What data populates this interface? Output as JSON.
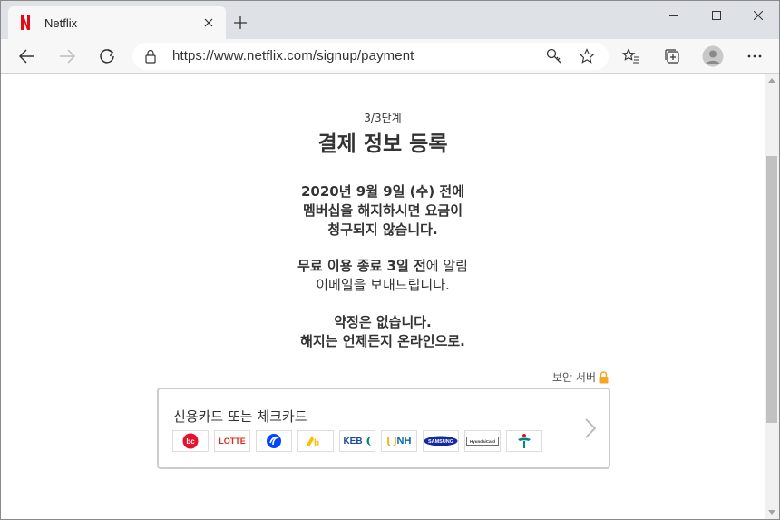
{
  "browser": {
    "tab_title": "Netflix",
    "url": "https://www.netflix.com/signup/payment"
  },
  "page": {
    "step": "3/3단계",
    "title": "결제 정보 등록",
    "notice1_line1": "2020년 9월 9일 (수) 전에",
    "notice1_line2": "멤버십을 해지하시면 요금이",
    "notice1_line3": "청구되지 않습니다.",
    "notice2_bold": "무료 이용 종료 3일 전",
    "notice2_rest": "에 알림",
    "notice2_line2": "이메일을 보내드립니다.",
    "notice3_line1": "약정은 없습니다.",
    "notice3_line2": "해지는 언제든지 온라인으로.",
    "secure_label": "보안 서버",
    "payment_option_label": "신용카드 또는 체크카드",
    "card_logos": [
      "bc-logo",
      "LOTTE",
      "shinhan-logo",
      "kb-logo",
      "KEB",
      "NH",
      "SAMSUNG",
      "HyundaiCard",
      "hana-logo"
    ]
  },
  "colors": {
    "netflix_red": "#e50914",
    "bc_red": "#e8112d",
    "lotte_red": "#da291c",
    "shinhan_blue": "#0046ff",
    "kb_yellow": "#ffbc00",
    "keb_blue": "#1e4a9c",
    "nh_blue": "#0069b4",
    "samsung_blue": "#1428a0",
    "hana_green": "#008485"
  }
}
